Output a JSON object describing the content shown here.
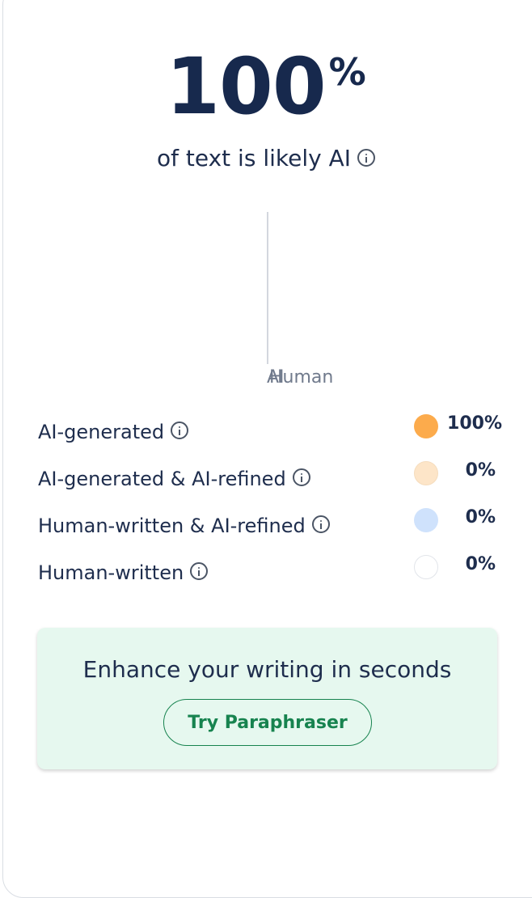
{
  "result": {
    "percent_value": "100",
    "percent_sign": "%",
    "subtitle": "of text is likely AI"
  },
  "chart_data": {
    "type": "bar",
    "categories": [
      "AI",
      "Human"
    ],
    "values": [
      100,
      0
    ]
  },
  "legend": [
    {
      "label": "AI-generated",
      "value": "100%",
      "color": "#fcab4c"
    },
    {
      "label": "AI-generated & AI-refined",
      "value": "0%",
      "color": "#fde5c8"
    },
    {
      "label": "Human-written & AI-refined",
      "value": "0%",
      "color": "#cfe2fc"
    },
    {
      "label": "Human-written",
      "value": "0%",
      "color": "#ffffff"
    }
  ],
  "promo": {
    "title": "Enhance your writing in seconds",
    "button_label": "Try Paraphraser"
  },
  "icons": {
    "info": "info-icon"
  }
}
